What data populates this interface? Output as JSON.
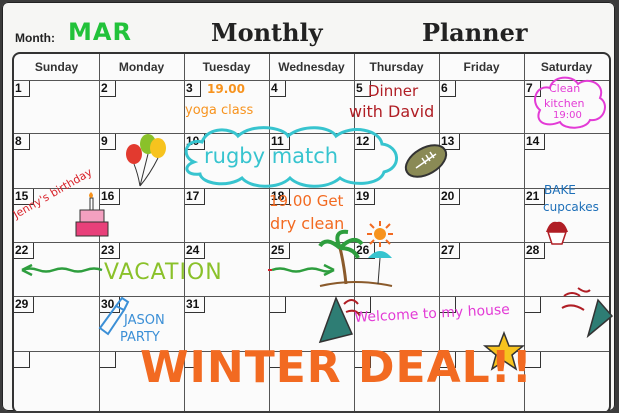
{
  "header": {
    "month_label": "Month:",
    "month_value": "MAR",
    "title_left": "Monthly",
    "title_right": "Planner"
  },
  "weekdays": [
    "Sunday",
    "Monday",
    "Tuesday",
    "Wednesday",
    "Thursday",
    "Friday",
    "Saturday"
  ],
  "dates": [
    "1",
    "2",
    "3",
    "4",
    "5",
    "6",
    "7",
    "8",
    "9",
    "10",
    "11",
    "12",
    "13",
    "14",
    "15",
    "16",
    "17",
    "18",
    "19",
    "20",
    "21",
    "22",
    "23",
    "24",
    "25",
    "26",
    "27",
    "28",
    "29",
    "30",
    "31"
  ],
  "notes": {
    "n3_time": "19.00",
    "n3_text": "yoga class",
    "n5": "Dinner",
    "n5b": "with David",
    "n7a": "Clean",
    "n7b": "kitchen",
    "n7c": "19:00",
    "rugby": "rugby match",
    "jenny": "Jenny's birthday",
    "n18a": "19.00 Get",
    "n18b": "dry clean",
    "n21a": "BAKE",
    "n21b": "cupcakes",
    "vacation": "VACATION",
    "jason1": "JASON",
    "jason2": "PARTY",
    "welcome": "Welcome to my house",
    "deal": "WINTER DEAL!!"
  },
  "colors": {
    "month": "#22c23a",
    "orange": "#f7931e",
    "red": "#d9222a",
    "pink": "#e33bd6",
    "teal": "#37c4cf",
    "green": "#8ac12a",
    "blue": "#3b8fd6",
    "deal": "#f26a21"
  }
}
